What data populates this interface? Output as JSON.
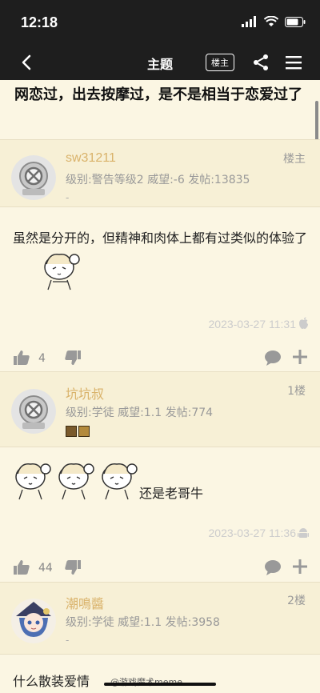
{
  "status": {
    "time": "12:18"
  },
  "nav": {
    "title": "主题",
    "op_badge": "楼主"
  },
  "topic": {
    "title": "网恋过，出去按摩过，是不是相当于恋爱过了"
  },
  "posts": [
    {
      "username": "sw31211",
      "stats": "级别:警告等级2  威望:-6  发帖:13835",
      "dash": "-",
      "floor": "楼主",
      "body": "虽然是分开的，但精神和肉体上都有过类似的体验了",
      "timestamp": "2023-03-27 11:31",
      "likes": "4"
    },
    {
      "username": "坑坑叔",
      "stats": "级别:学徒  威望:1.1  发帖:774",
      "floor": "1楼",
      "body": "还是老哥牛",
      "timestamp": "2023-03-27 11:36",
      "likes": "44"
    },
    {
      "username": "潮鳴醬",
      "stats": "级别:学徒  威望:1.1  发帖:3958",
      "dash": "-",
      "floor": "2楼",
      "body": "什么散装爱情"
    }
  ],
  "watermark": "@游戏魔术meme",
  "colors": {
    "bar": "#1e1e1e",
    "background": "#fbf6e3",
    "header": "#f7f0d6",
    "username": "#d9b26a"
  }
}
